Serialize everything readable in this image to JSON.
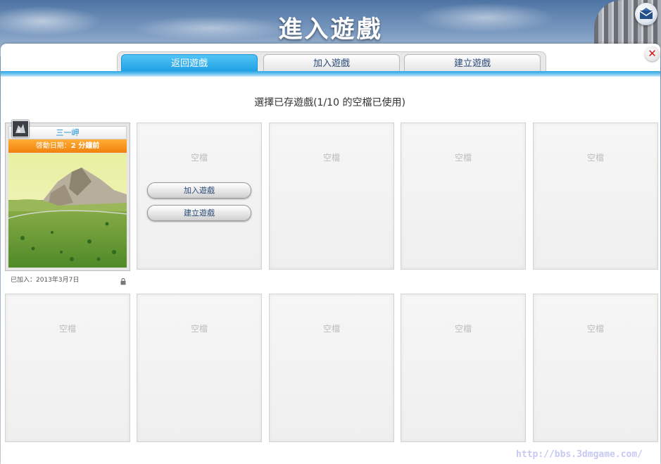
{
  "header": {
    "title": "進入遊戲"
  },
  "tabs": [
    {
      "label": "返回遊戲"
    },
    {
      "label": "加入遊戲"
    },
    {
      "label": "建立遊戲"
    }
  ],
  "subtitle": "選擇已存遊戲(1/10 的空檔已使用)",
  "saved_game": {
    "name": "三一岬",
    "status_prefix": "啓動日期：",
    "status_value": "2 分鐘前",
    "joined": "已加入：2013年3月7日"
  },
  "empty_slot_label": "空檔",
  "slot_actions": {
    "join": "加入遊戲",
    "create": "建立遊戲"
  },
  "close_glyph": "✕",
  "watermark": "http://bbs.3dmgame.com/",
  "colors": {
    "accent": "#1b9ee3",
    "status": "#f0820d",
    "close": "#d4151b"
  }
}
